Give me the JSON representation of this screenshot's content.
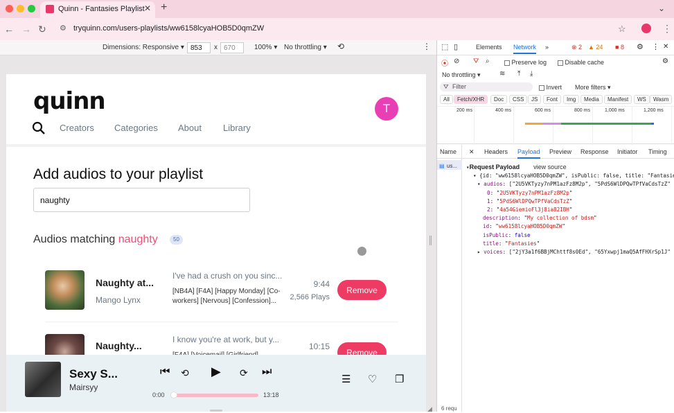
{
  "browser": {
    "tab_title": "Quinn - Fantasies Playlist",
    "url": "tryquinn.com/users-playlists/ww6158lcyaHOB5D0qmZW"
  },
  "device_toolbar": {
    "dimensions_label": "Dimensions: Responsive",
    "width": "853",
    "sep": "x",
    "height": "670",
    "zoom": "100%",
    "throttle": "No throttling"
  },
  "site": {
    "logo": "quinn",
    "avatar_letter": "T",
    "nav": [
      "Creators",
      "Categories",
      "About",
      "Library"
    ],
    "heading": "Add audios to your playlist",
    "search_value": "naughty",
    "match_prefix": "Audios matching",
    "match_query": "naughty",
    "match_count": "50",
    "rows": [
      {
        "title": "Naughty at...",
        "artist": "Mango Lynx",
        "desc": "I've had a crush on you sinc...",
        "tags": "[NB4A] [F4A] [Happy Monday] [Co-workers] [Nervous] [Confession]...",
        "duration": "9:44",
        "plays": "2,566 Plays",
        "button": "Remove"
      },
      {
        "title": "Naughty...",
        "artist": "",
        "desc": "I know you're at work, but y...",
        "tags": "[F4A] [Voicemail] [Girlfriend]",
        "duration": "10:15",
        "plays": "",
        "button": "Remove"
      }
    ]
  },
  "player": {
    "title": "Sexy S...",
    "artist": "Mairsyy",
    "time_current": "0:00",
    "time_total": "13:18",
    "progress": 0.0
  },
  "devtools": {
    "tabs": [
      "Elements",
      "Network"
    ],
    "errors": "2",
    "warnings": "24",
    "issues": "8",
    "preserve_log": "Preserve log",
    "disable_cache": "Disable cache",
    "throttle": "No throttling",
    "filter_placeholder": "Filter",
    "invert": "Invert",
    "more_filters": "More filters",
    "types": [
      "All",
      "Fetch/XHR",
      "Doc",
      "CSS",
      "JS",
      "Font",
      "Img",
      "Media",
      "Manifest",
      "WS",
      "Wasm"
    ],
    "ticks": [
      "200 ms",
      "400 ms",
      "600 ms",
      "800 ms",
      "1,000 ms",
      "1,200 ms"
    ],
    "subtabs": [
      "Name",
      "Headers",
      "Payload",
      "Preview",
      "Response",
      "Initiator",
      "Timing"
    ],
    "request_name": "us...",
    "section": "Request Payload",
    "view_source": "view source",
    "payload_line": "{id: \"ww6158lcyaHOB5D0qmZW\", isPublic: false, title: \"Fantasies\"",
    "audios_line": "[\"2U5VKTyzy7nPM1azFz8M2p\", \"5PdS6WlDPQwTPfVaCdsTzZ\"",
    "audios": [
      "2U5VKTyzy7nPM1azFz8M2p",
      "5PdS6WlDPQwTPfVaCdsTzZ",
      "4a54GiemioFl3j8ia82IBH"
    ],
    "description": "My collection of bdsm",
    "id": "ww6158lcyaHOB5D0qmZW",
    "isPublic": "false",
    "title": "Fantasies",
    "voices_line": "[\"2jY3a1f6BBjMChttf8s0Ed\", \"65Yxwpj1maQ5AfFHXrSp1J\"",
    "requests": "6 requ"
  }
}
